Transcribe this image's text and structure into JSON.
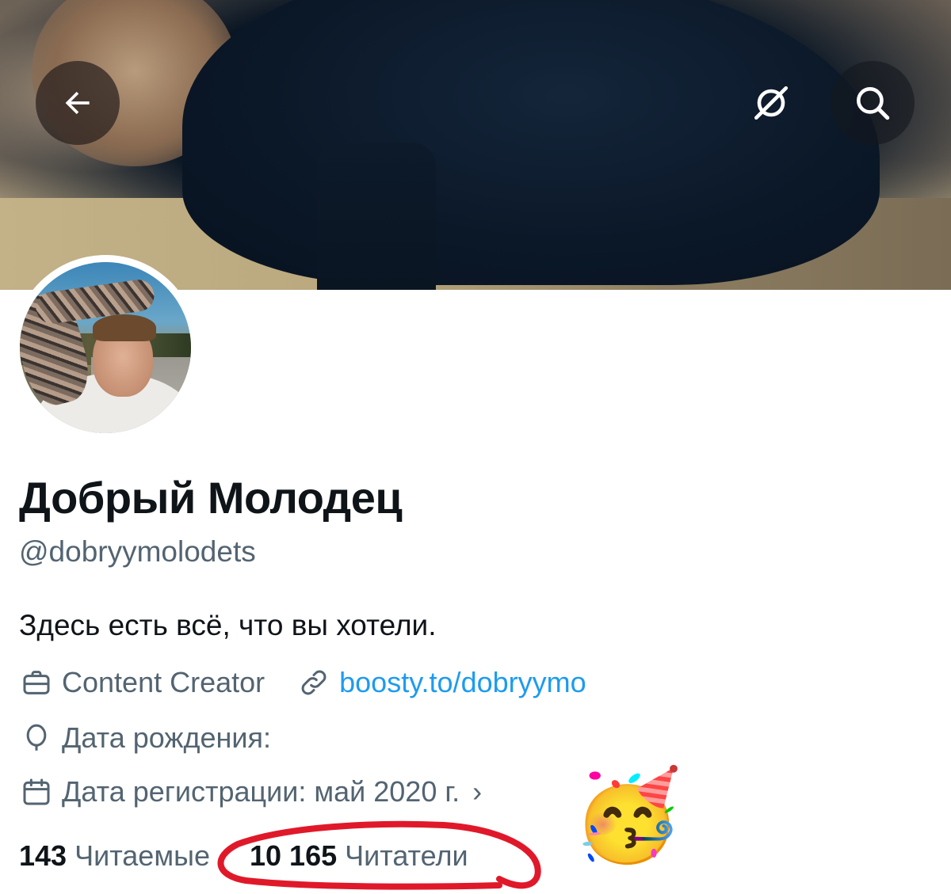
{
  "header": {
    "back_icon": "arrow-left-icon",
    "grok_icon": "grok-icon",
    "search_icon": "search-icon"
  },
  "profile": {
    "name": "Добрый Молодец",
    "handle": "@dobryymolodets",
    "bio": "Здесь есть всё, что вы хотели.",
    "category": "Content Creator",
    "website": "boosty.to/dobryymo",
    "birthday": "Дата рождения:",
    "joined": "Дата регистрации: май 2020 г.",
    "joined_chevron": "›"
  },
  "stats": {
    "following_count": "143",
    "following_label": "Читаемые",
    "followers_count": "10 165",
    "followers_label": "Читатели"
  },
  "decorations": {
    "emoji": "🥳",
    "annotation_color": "#e0192a"
  }
}
